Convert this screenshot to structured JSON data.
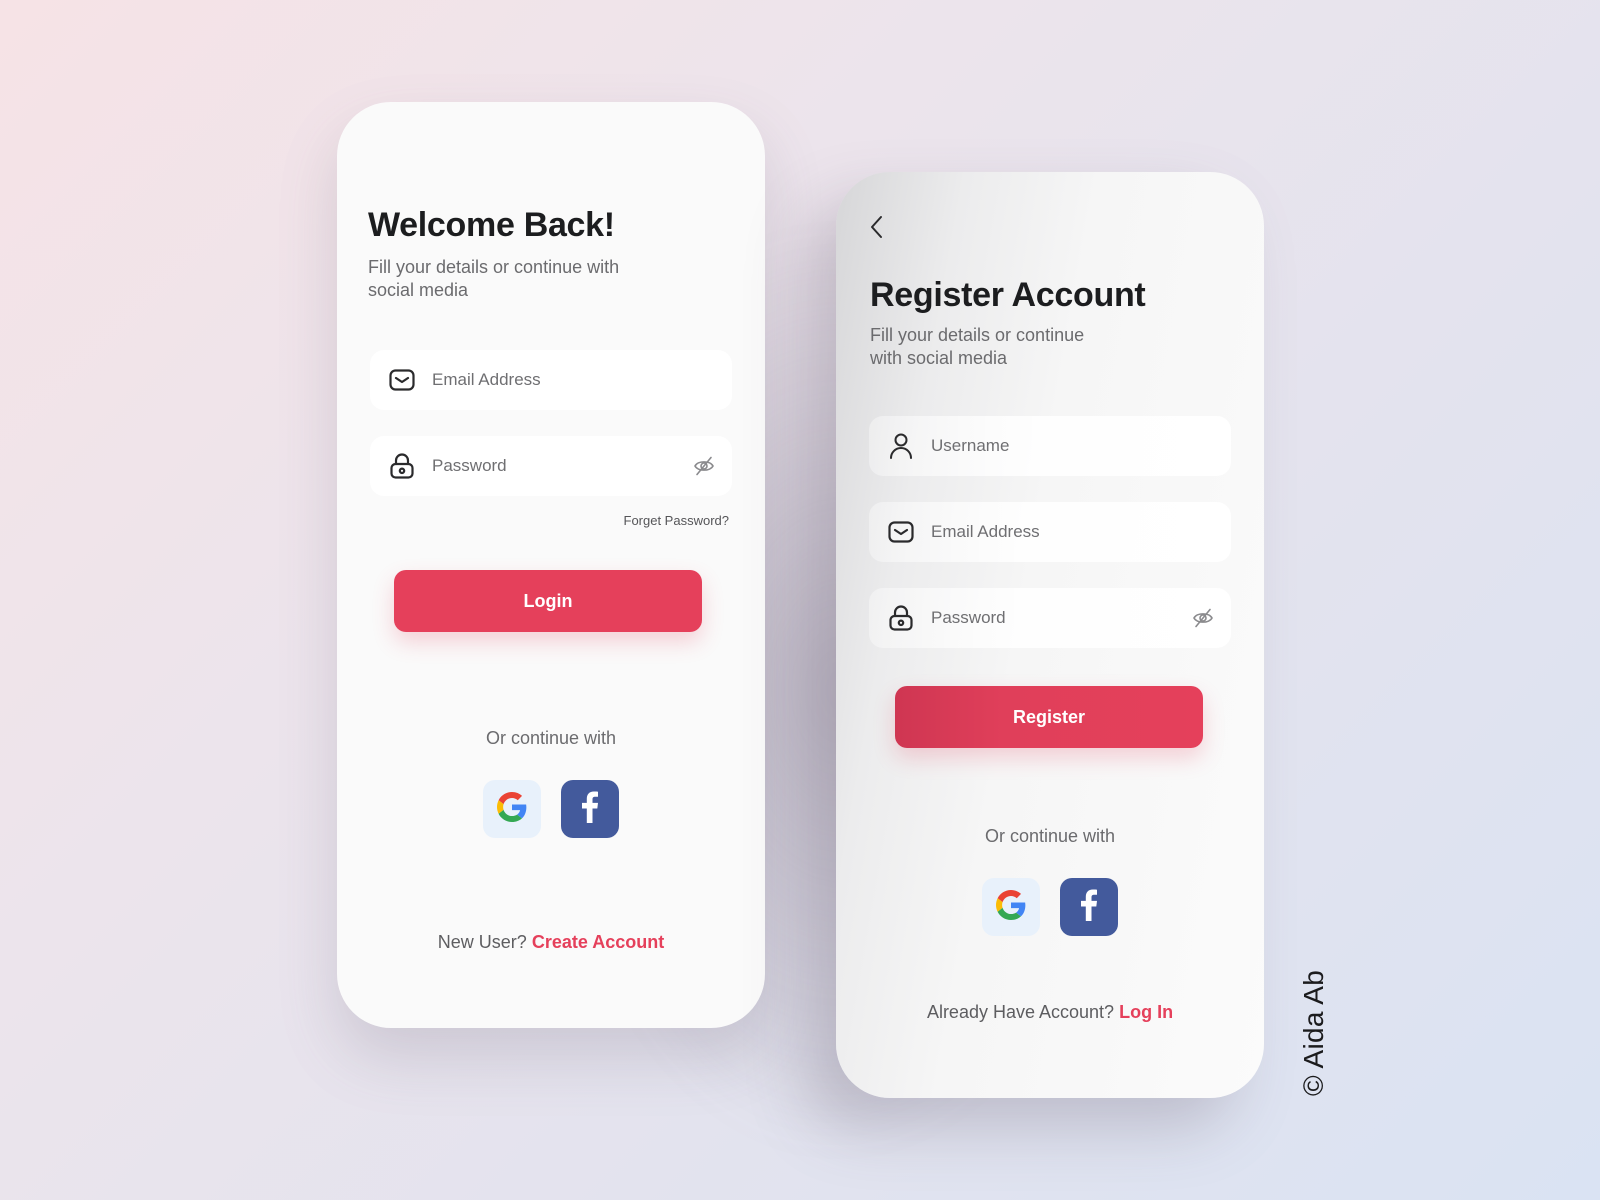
{
  "colors": {
    "accent": "#e5405b",
    "facebook": "#435a9c",
    "google_tile": "#e8f1fb",
    "title_text": "#1c1d1f",
    "muted_text": "#6b6b6e"
  },
  "login_screen": {
    "title": "Welcome Back!",
    "subtitle_line1": "Fill your details or continue with",
    "subtitle_line2": "social media",
    "fields": [
      {
        "icon": "mail-icon",
        "placeholder": "Email Address",
        "value": ""
      },
      {
        "icon": "lock-icon",
        "placeholder": "Password",
        "value": "",
        "trailing_icon": "eye-off-icon"
      }
    ],
    "forgot_password": "Forget Password?",
    "primary_button": "Login",
    "or_continue": "Or continue with",
    "social": [
      {
        "name": "Google",
        "icon": "google-icon"
      },
      {
        "name": "Facebook",
        "icon": "facebook-icon"
      }
    ],
    "footer_prompt": "New User?",
    "footer_link": "Create Account"
  },
  "register_screen": {
    "back_icon": "chevron-left-icon",
    "title": "Register Account",
    "subtitle_line1": "Fill your details or continue",
    "subtitle_line2": "with social media",
    "fields": [
      {
        "icon": "user-icon",
        "placeholder": "Username",
        "value": ""
      },
      {
        "icon": "mail-icon",
        "placeholder": "Email Address",
        "value": ""
      },
      {
        "icon": "lock-icon",
        "placeholder": "Password",
        "value": "",
        "trailing_icon": "eye-off-icon"
      }
    ],
    "primary_button": "Register",
    "or_continue": "Or continue with",
    "social": [
      {
        "name": "Google",
        "icon": "google-icon"
      },
      {
        "name": "Facebook",
        "icon": "facebook-icon"
      }
    ],
    "footer_prompt": "Already Have Account?",
    "footer_link": "Log In"
  },
  "credit": "© Aida Ab"
}
